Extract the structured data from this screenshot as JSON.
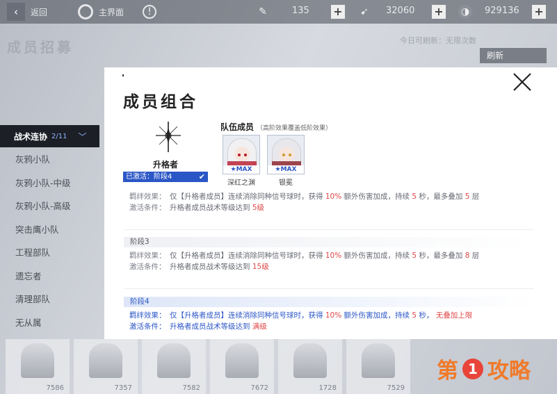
{
  "topbar": {
    "back_label": "返回",
    "home_label": "主界面",
    "stamina": "135",
    "currency1": "32060",
    "currency2": "929136"
  },
  "background": {
    "title": "成员招募",
    "note": "今日可刷新：无限次数",
    "refresh_label": "刷新",
    "cards": [
      "7586",
      "7357",
      "7582",
      "7672",
      "1728",
      "7529"
    ]
  },
  "sidebar": {
    "header": "战术连协",
    "count": "2/11",
    "items": [
      "灰鸦小队",
      "灰鸦小队-中级",
      "灰鸦小队-高级",
      "突击鹰小队",
      "工程部队",
      "遗忘者",
      "清理部队",
      "无从属"
    ]
  },
  "panel": {
    "title": "成员组合",
    "role": {
      "name": "升格者",
      "status": "已激活：阶段4"
    },
    "team": {
      "title": "队伍成员",
      "note": "（高阶效果覆盖低阶效果）",
      "members": [
        {
          "name": "深红之渊",
          "badge": "★MAX"
        },
        {
          "name": "银冕",
          "badge": "★MAX"
        }
      ]
    },
    "stages": [
      {
        "header": "",
        "effect_label": "羁绊效果：",
        "effect_prefix": "仅【升格者成员】连续消除同种信号球时，获得",
        "pct": "10%",
        "effect_mid": "额外伤害加成，持续",
        "dur": "5",
        "effect_mid2": "秒，最多叠加",
        "stack": "5",
        "effect_suffix": "层",
        "cond_label": "激活条件：",
        "cond_prefix": "升格者成员战术等级达到",
        "cond_value": "5级"
      },
      {
        "header": "阶段3",
        "effect_label": "羁绊效果：",
        "effect_prefix": "仅【升格者成员】连续消除同种信号球时，获得",
        "pct": "10%",
        "effect_mid": "额外伤害加成，持续",
        "dur": "5",
        "effect_mid2": "秒，最多叠加",
        "stack": "8",
        "effect_suffix": "层",
        "cond_label": "激活条件：",
        "cond_prefix": "升格者成员战术等级达到",
        "cond_value": "15级"
      },
      {
        "header": "阶段4",
        "effect_label": "羁绊效果：",
        "effect_prefix": "仅【升格者成员】连续消除同种信号球时，获得",
        "pct": "10%",
        "effect_mid": "额外伤害加成，持续",
        "dur": "5",
        "effect_mid2": "秒，",
        "stack": "无叠加上限",
        "effect_suffix": "",
        "cond_label": "激活条件：",
        "cond_prefix": "升格者成员战术等级达到",
        "cond_value": "满级"
      }
    ]
  },
  "watermark": {
    "left": "第",
    "num": "1",
    "right": "攻略"
  },
  "colors": {
    "accent_blue": "#2b56c6",
    "highlight_red": "#e04848",
    "watermark_orange": "#f07a2a"
  }
}
